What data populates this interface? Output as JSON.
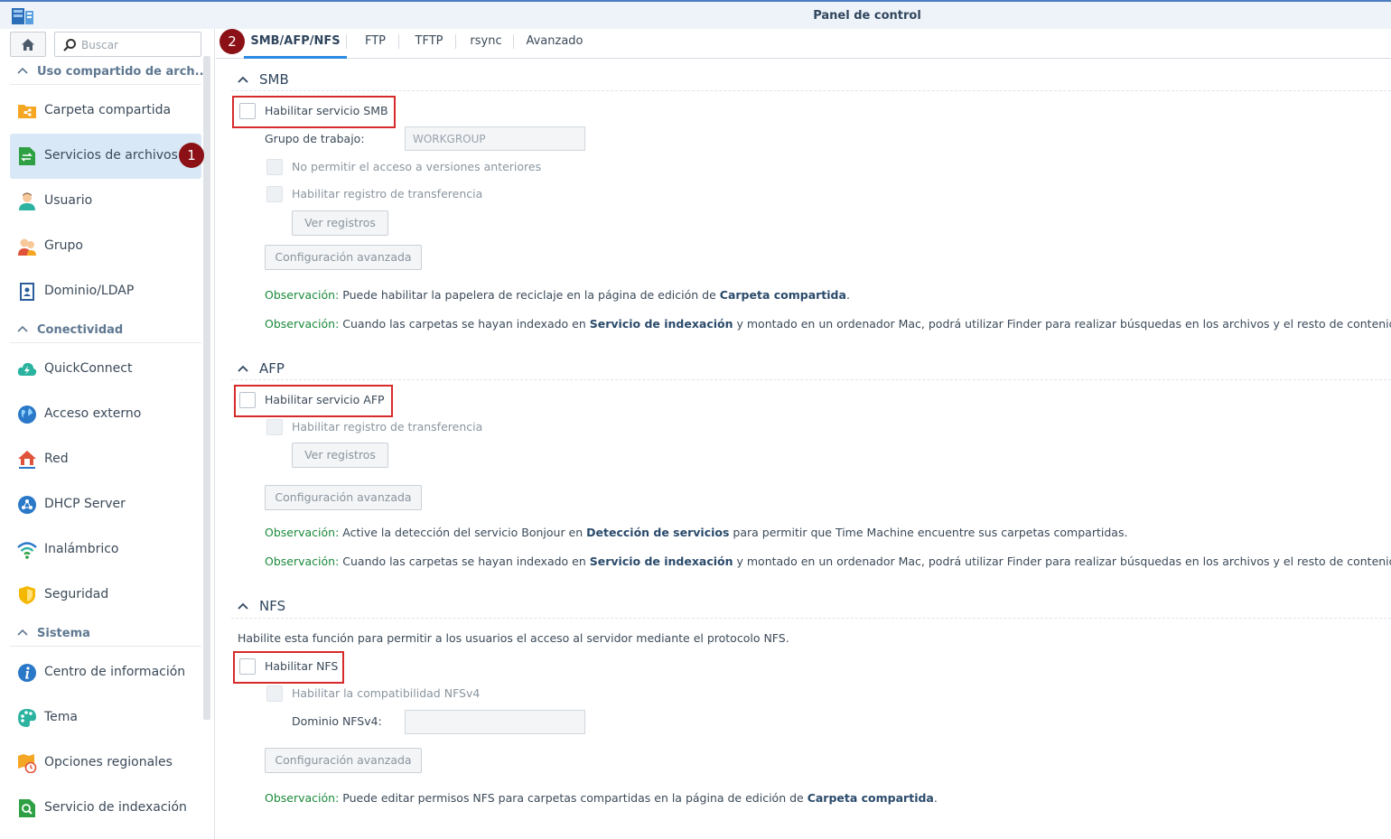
{
  "window": {
    "title": "Panel de control"
  },
  "sidebar": {
    "search_placeholder": "Buscar",
    "groups": [
      {
        "label": "Uso compartido de arch..."
      },
      {
        "label": "Conectividad"
      },
      {
        "label": "Sistema"
      }
    ],
    "items": [
      {
        "label": "Carpeta compartida",
        "icon": "shared-folder-icon"
      },
      {
        "label": "Servicios de archivos",
        "icon": "file-services-icon",
        "active": true
      },
      {
        "label": "Usuario",
        "icon": "user-icon"
      },
      {
        "label": "Grupo",
        "icon": "group-icon"
      },
      {
        "label": "Dominio/LDAP",
        "icon": "domain-ldap-icon"
      },
      {
        "label": "QuickConnect",
        "icon": "quickconnect-icon"
      },
      {
        "label": "Acceso externo",
        "icon": "external-access-icon"
      },
      {
        "label": "Red",
        "icon": "network-icon"
      },
      {
        "label": "DHCP Server",
        "icon": "dhcp-server-icon"
      },
      {
        "label": "Inalámbrico",
        "icon": "wireless-icon"
      },
      {
        "label": "Seguridad",
        "icon": "security-icon"
      },
      {
        "label": "Centro de información",
        "icon": "info-center-icon"
      },
      {
        "label": "Tema",
        "icon": "theme-icon"
      },
      {
        "label": "Opciones regionales",
        "icon": "regional-options-icon"
      },
      {
        "label": "Servicio de indexación",
        "icon": "indexing-service-icon"
      }
    ]
  },
  "badges": {
    "first": "1",
    "second": "2"
  },
  "tabs": [
    {
      "label": "SMB/AFP/NFS",
      "active": true
    },
    {
      "label": "FTP"
    },
    {
      "label": "TFTP"
    },
    {
      "label": "rsync"
    },
    {
      "label": "Avanzado"
    }
  ],
  "smb": {
    "title": "SMB",
    "enable_label": "Habilitar servicio SMB",
    "workgroup_label": "Grupo de trabajo:",
    "workgroup_value": "WORKGROUP",
    "no_prev_versions_label": "No permitir el acceso a versiones anteriores",
    "transfer_log_label": "Habilitar registro de transferencia",
    "view_logs_button": "Ver registros",
    "advanced_button": "Configuración avanzada",
    "note1": {
      "prefix": "Observación:",
      "text": " Puede habilitar la papelera de reciclaje en la página de edición de ",
      "link": "Carpeta compartida",
      "suffix": "."
    },
    "note2": {
      "prefix": "Observación:",
      "text": " Cuando las carpetas se hayan indexado en ",
      "link": "Servicio de indexación",
      "suffix": " y montado en un ordenador Mac, podrá utilizar Finder para realizar búsquedas en los archivos y el resto de contenidos."
    }
  },
  "afp": {
    "title": "AFP",
    "enable_label": "Habilitar servicio AFP",
    "transfer_log_label": "Habilitar registro de transferencia",
    "view_logs_button": "Ver registros",
    "advanced_button": "Configuración avanzada",
    "note1": {
      "prefix": "Observación:",
      "text": " Active la detección del servicio Bonjour en ",
      "link": "Detección de servicios",
      "suffix": " para permitir que Time Machine encuentre sus carpetas compartidas."
    },
    "note2": {
      "prefix": "Observación:",
      "text": " Cuando las carpetas se hayan indexado en ",
      "link": "Servicio de indexación",
      "suffix": " y montado en un ordenador Mac, podrá utilizar Finder para realizar búsquedas en los archivos y el resto de contenidos."
    }
  },
  "nfs": {
    "title": "NFS",
    "description": "Habilite esta función para permitir a los usuarios el acceso al servidor mediante el protocolo NFS.",
    "enable_label": "Habilitar NFS",
    "nfsv4_label": "Habilitar la compatibilidad NFSv4",
    "domain_label": "Dominio NFSv4:",
    "domain_value": "",
    "advanced_button": "Configuración avanzada",
    "note1": {
      "prefix": "Observación:",
      "text": " Puede editar permisos NFS para carpetas compartidas en la página de edición de ",
      "link": "Carpeta compartida",
      "suffix": "."
    }
  },
  "colors": {
    "accent": "#2b8ae2",
    "highlight_box": "#d72b2b",
    "badge": "#8b1116",
    "note_label": "#1a8a3a"
  }
}
